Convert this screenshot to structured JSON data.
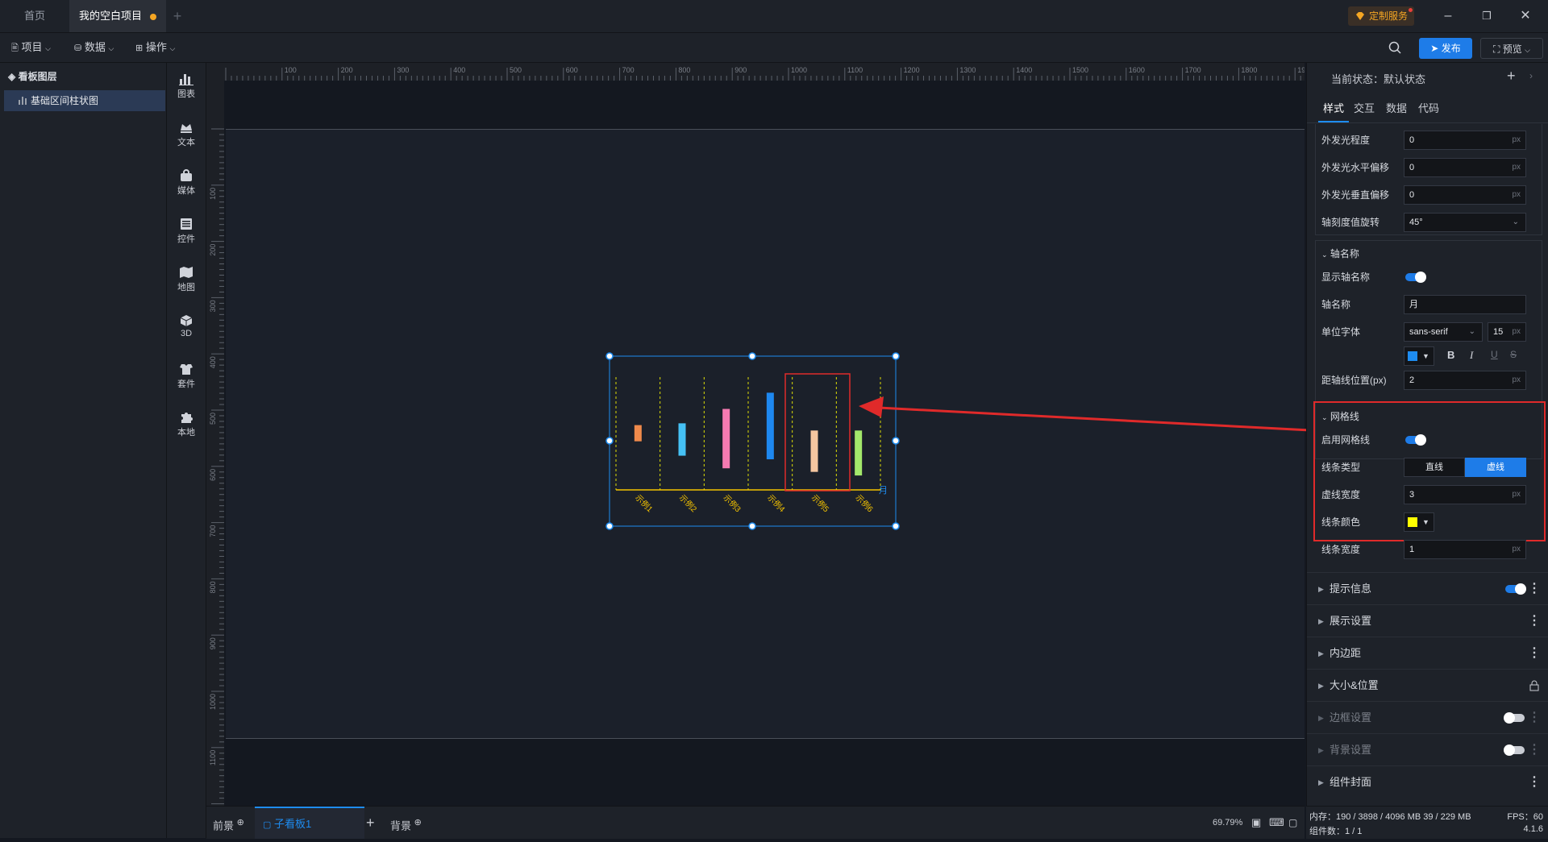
{
  "window": {
    "tabs": [
      {
        "label": "首页"
      },
      {
        "label": "我的空白项目"
      }
    ],
    "custom_service": "定制服务"
  },
  "menubar": {
    "items": [
      {
        "label": "项目"
      },
      {
        "label": "数据"
      },
      {
        "label": "操作"
      }
    ],
    "publish": "发布",
    "preview": "预览"
  },
  "layers": {
    "title": "看板图层",
    "items": [
      {
        "label": "基础区间柱状图"
      }
    ]
  },
  "tools": [
    {
      "label": "图表",
      "icon": "bar-chart-icon"
    },
    {
      "label": "文本",
      "icon": "text-icon"
    },
    {
      "label": "媒体",
      "icon": "media-icon"
    },
    {
      "label": "控件",
      "icon": "control-icon"
    },
    {
      "label": "地图",
      "icon": "map-icon"
    },
    {
      "label": "3D",
      "icon": "cube-icon"
    },
    {
      "label": "套件",
      "icon": "kit-icon"
    },
    {
      "label": "本地",
      "icon": "puzzle-icon"
    }
  ],
  "rulers": {
    "h_labels": [
      "100",
      "200",
      "300",
      "400",
      "500",
      "600",
      "700",
      "800",
      "900",
      "1000",
      "1100",
      "1200",
      "1300",
      "1400",
      "1500",
      "1600",
      "1700",
      "1800",
      "1900"
    ],
    "v_labels": [
      "100",
      "200",
      "300",
      "400",
      "500",
      "600",
      "700",
      "800",
      "900",
      "1000",
      "1100"
    ]
  },
  "chart_data": {
    "type": "bar",
    "categories": [
      "示例1",
      "示例2",
      "示例3",
      "示例4",
      "示例5",
      "示例6"
    ],
    "ranges": [
      [
        27,
        36
      ],
      [
        19,
        37
      ],
      [
        12,
        45
      ],
      [
        17,
        54
      ],
      [
        10,
        33
      ],
      [
        8,
        33
      ]
    ],
    "colors": [
      "#f08a4b",
      "#45c1f5",
      "#f57ab1",
      "#1e88f0",
      "#f5c6a0",
      "#a3e86b"
    ],
    "xlabel": "月",
    "axis_color": "#f5c400",
    "grid": {
      "enabled": true,
      "type": "dashed",
      "color": "#ffff00"
    }
  },
  "bottom": {
    "tabs": [
      {
        "label": "前景"
      },
      {
        "label": "子看板1"
      },
      {
        "label": "背景"
      }
    ],
    "zoom": "69.79%"
  },
  "rpanel": {
    "state_label": "当前状态：默认状态",
    "tabs": [
      {
        "label": "样式"
      },
      {
        "label": "交互"
      },
      {
        "label": "数据"
      },
      {
        "label": "代码"
      }
    ],
    "glow": [
      {
        "label": "外发光程度",
        "value": "0",
        "unit": "px"
      },
      {
        "label": "外发光水平偏移",
        "value": "0",
        "unit": "px"
      },
      {
        "label": "外发光垂直偏移",
        "value": "0",
        "unit": "px"
      }
    ],
    "tick_rotate": {
      "label": "轴刻度值旋转",
      "value": "45°"
    },
    "axis_name": {
      "title": "轴名称",
      "show_label": "显示轴名称",
      "name_label": "轴名称",
      "name_value": "月",
      "font_label": "单位字体",
      "font_value": "sans-serif",
      "font_size": "15",
      "font_unit": "px",
      "color": "#1e8cf0",
      "offset_label": "距轴线位置(px)",
      "offset_value": "2",
      "offset_unit": "px"
    },
    "grid": {
      "title": "网格线",
      "enable_label": "启用网格线",
      "type_label": "线条类型",
      "type_options": [
        "直线",
        "虚线"
      ],
      "dash_label": "虚线宽度",
      "dash_value": "3",
      "dash_unit": "px",
      "color_label": "线条颜色",
      "color": "#ffff00",
      "width_label": "线条宽度",
      "width_value": "1",
      "width_unit": "px"
    },
    "sections": [
      {
        "label": "提示信息"
      },
      {
        "label": "展示设置"
      },
      {
        "label": "内边距"
      },
      {
        "label": "大小&位置"
      },
      {
        "label": "边框设置"
      },
      {
        "label": "背景设置"
      },
      {
        "label": "组件封面"
      }
    ]
  },
  "status": {
    "memory": "内存：190 / 3898 / 4096 MB 39 / 229 MB",
    "fps": "FPS：60",
    "count": "组件数：1 / 1",
    "version": "4.1.6"
  }
}
